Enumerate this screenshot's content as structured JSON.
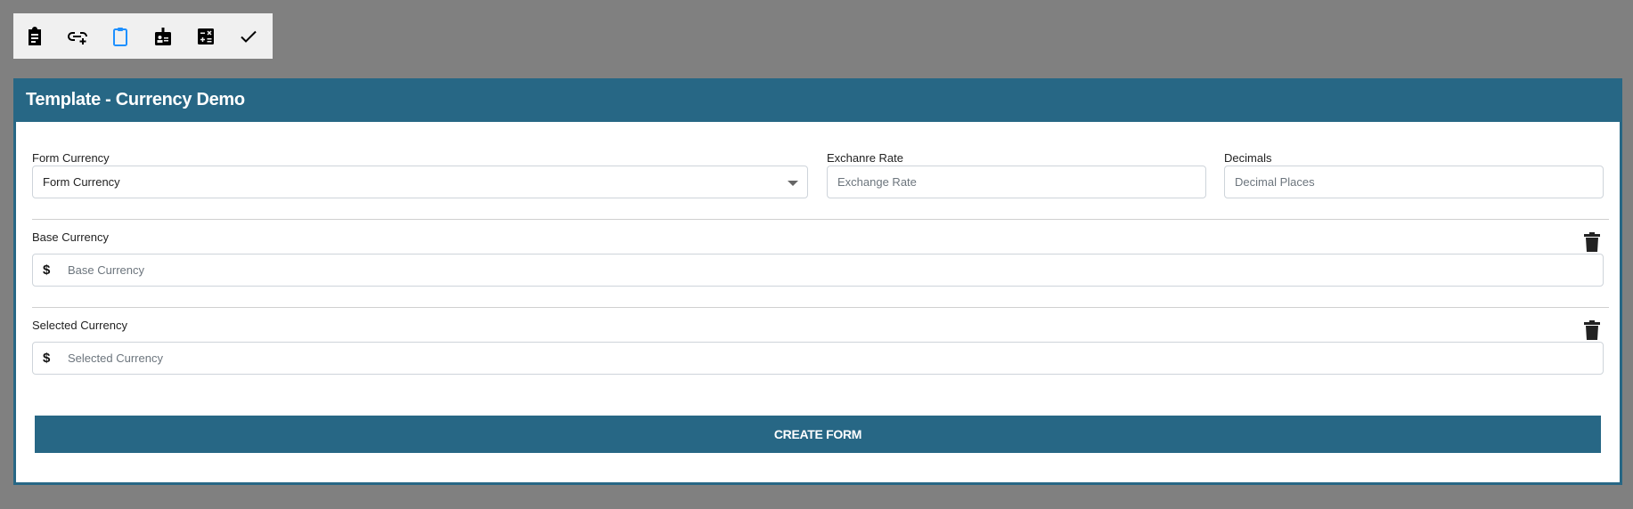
{
  "toolbar": {
    "items": [
      {
        "icon": "clipboard-list-icon",
        "active": false
      },
      {
        "icon": "link-add-icon",
        "active": false
      },
      {
        "icon": "clipboard-icon",
        "active": true
      },
      {
        "icon": "id-badge-icon",
        "active": false
      },
      {
        "icon": "calculator-icon",
        "active": false
      },
      {
        "icon": "checkmark-icon",
        "active": false
      }
    ],
    "active_color": "#1e90ff"
  },
  "card": {
    "title": "Template - Currency Demo",
    "accent_color": "#276785"
  },
  "form": {
    "form_currency": {
      "label": "Form Currency",
      "value": "Form Currency"
    },
    "exchange_rate": {
      "label": "Exchanre Rate",
      "placeholder": "Exchange Rate"
    },
    "decimals": {
      "label": "Decimals",
      "placeholder": "Decimal Places"
    },
    "base_currency": {
      "label": "Base Currency",
      "prefix": "$",
      "placeholder": "Base Currency"
    },
    "selected_currency": {
      "label": "Selected Currency",
      "prefix": "$",
      "placeholder": "Selected Currency"
    },
    "create_button": "CREATE FORM"
  }
}
